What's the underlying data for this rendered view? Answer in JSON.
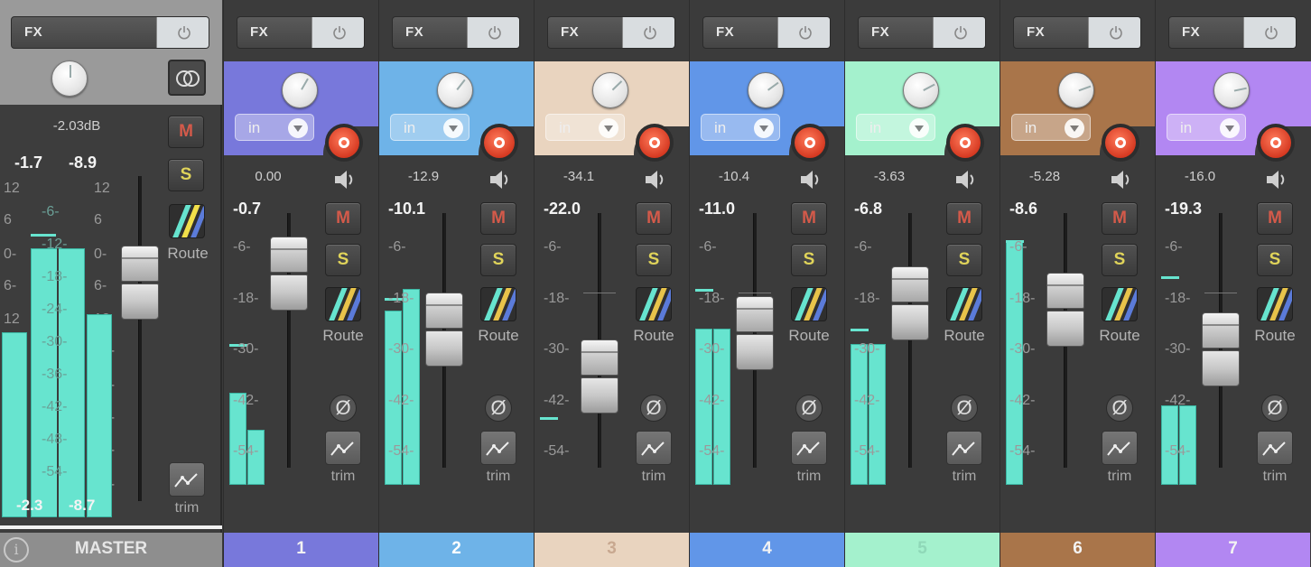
{
  "master": {
    "fx_label": "FX",
    "peak_db": "-2.03dB",
    "left_peak": "-1.7",
    "right_peak": "-8.9",
    "scale_outer": [
      "12",
      "6",
      "0-",
      "6-",
      "12",
      "18-",
      "24-",
      "30-",
      "36-",
      "42-"
    ],
    "scale_inner": [
      "-6-",
      "-12-",
      "-18-",
      "-24-",
      "-30-",
      "-36-",
      "-42-",
      "-48-",
      "-54-"
    ],
    "meter_left_value": "-2.3",
    "meter_right_value": "-8.7",
    "mute_label": "M",
    "solo_label": "S",
    "route_label": "Route",
    "trim_label": "trim",
    "name": "MASTER",
    "info_icon": "info-icon",
    "stereo_icon": "stereo-icon"
  },
  "scale_labels": [
    "-6-",
    "-18-",
    "-30-",
    "-42-",
    "-54-"
  ],
  "colors": {
    "meter": "#67e4cf",
    "mute": "#d45a4a",
    "solo": "#e0d45a",
    "record": "#d63a22"
  },
  "tracks": [
    {
      "number": "1",
      "color": "#7878db",
      "peak": "0.00",
      "volume": "-0.7",
      "fx_label": "FX",
      "input_label": "in",
      "mute_label": "M",
      "solo_label": "S",
      "route_label": "Route",
      "phase_glyph": "Ø",
      "trim_label": "trim",
      "meter_levels": [
        0.3,
        0.18
      ],
      "peak_hold": 0.46,
      "fader_level": 0.9
    },
    {
      "number": "2",
      "color": "#6eb3e8",
      "peak": "-12.9",
      "volume": "-10.1",
      "fx_label": "FX",
      "input_label": "in",
      "mute_label": "M",
      "solo_label": "S",
      "route_label": "Route",
      "phase_glyph": "Ø",
      "trim_label": "trim",
      "meter_levels": [
        0.57,
        0.64
      ],
      "peak_hold": 0.61,
      "fader_level": 0.62
    },
    {
      "number": "3",
      "color": "#e9d4bf",
      "peak": "-34.1",
      "volume": "-22.0",
      "fx_label": "FX",
      "input_label": "in",
      "mute_label": "M",
      "solo_label": "S",
      "route_label": "Route",
      "phase_glyph": "Ø",
      "trim_label": "trim",
      "meter_levels": [
        0.0,
        0.0
      ],
      "peak_hold": 0.22,
      "fader_level": 0.38
    },
    {
      "number": "4",
      "color": "#6196e8",
      "peak": "-10.4",
      "volume": "-11.0",
      "fx_label": "FX",
      "input_label": "in",
      "mute_label": "M",
      "solo_label": "S",
      "route_label": "Route",
      "phase_glyph": "Ø",
      "trim_label": "trim",
      "meter_levels": [
        0.51,
        0.51
      ],
      "peak_hold": 0.64,
      "fader_level": 0.6
    },
    {
      "number": "5",
      "color": "#a4f1cd",
      "peak": "-3.63",
      "volume": "-6.8",
      "fx_label": "FX",
      "input_label": "in",
      "mute_label": "M",
      "solo_label": "S",
      "route_label": "Route",
      "phase_glyph": "Ø",
      "trim_label": "trim",
      "meter_levels": [
        0.46,
        0.46
      ],
      "peak_hold": 0.51,
      "fader_level": 0.75
    },
    {
      "number": "6",
      "color": "#a9754a",
      "peak": "-5.28",
      "volume": "-8.6",
      "fx_label": "FX",
      "input_label": "in",
      "mute_label": "M",
      "solo_label": "S",
      "route_label": "Route",
      "phase_glyph": "Ø",
      "trim_label": "trim",
      "meter_levels": [
        0.8,
        0.0
      ],
      "peak_hold": 0.8,
      "fader_level": 0.72
    },
    {
      "number": "7",
      "color": "#b287f2",
      "peak": "-16.0",
      "volume": "-19.3",
      "fx_label": "FX",
      "input_label": "in",
      "mute_label": "M",
      "solo_label": "S",
      "route_label": "Route",
      "phase_glyph": "Ø",
      "trim_label": "trim",
      "meter_levels": [
        0.26,
        0.26
      ],
      "peak_hold": 0.68,
      "fader_level": 0.52
    }
  ]
}
